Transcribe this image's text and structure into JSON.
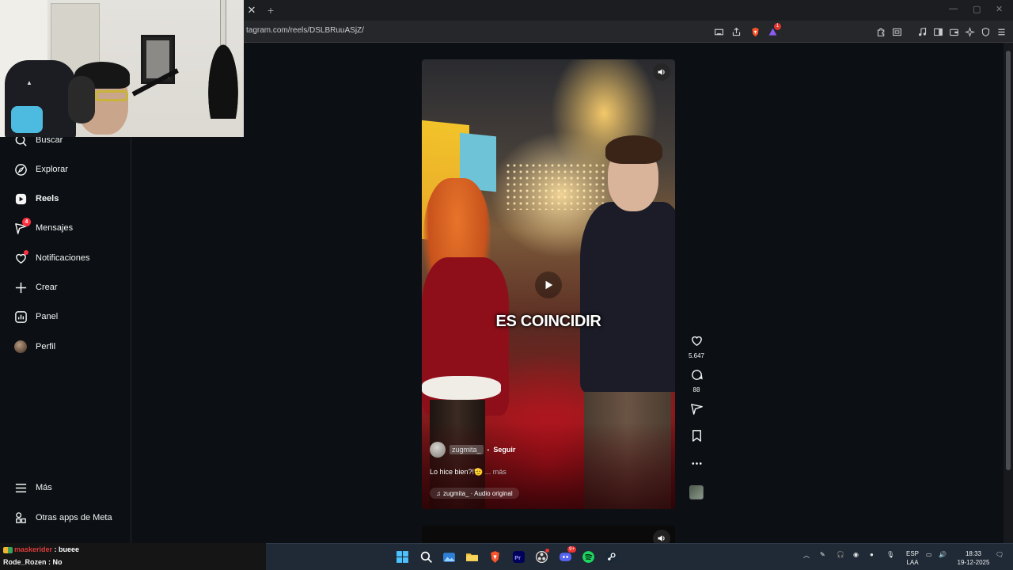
{
  "browser": {
    "url": "tagram.com/reels/DSLBRuuASjZ/",
    "extension_badge": "1"
  },
  "sidebar": {
    "items": [
      {
        "label": "Buscar",
        "icon": "search-icon"
      },
      {
        "label": "Explorar",
        "icon": "compass-icon"
      },
      {
        "label": "Reels",
        "icon": "reels-icon"
      },
      {
        "label": "Mensajes",
        "icon": "messenger-icon",
        "badge": "4"
      },
      {
        "label": "Notificaciones",
        "icon": "heart-icon"
      },
      {
        "label": "Crear",
        "icon": "plus-icon"
      },
      {
        "label": "Panel",
        "icon": "chart-icon"
      },
      {
        "label": "Perfil",
        "icon": "avatar"
      },
      {
        "label": "Más",
        "icon": "menu-icon"
      },
      {
        "label": "Otras apps de Meta",
        "icon": "apps-icon"
      }
    ]
  },
  "reel": {
    "caption_overlay": "ES COINCIDIR",
    "username": "zugmita_",
    "separator": "•",
    "follow_label": "Seguir",
    "description": "Lo hice bien?!🫡",
    "more_label": "... más",
    "audio": "zugmita_ · Audio original"
  },
  "actions": {
    "likes": "5.647",
    "comments": "88"
  },
  "chat": {
    "messages": [
      {
        "user": "maskerider",
        "text": "bueee"
      },
      {
        "user": "Rode_Rozen",
        "text": "No"
      }
    ]
  },
  "taskbar": {
    "lang_line1": "ESP",
    "lang_line2": "LAA",
    "time": "18:33",
    "date": "19-12-2025",
    "discord_badge": "9+"
  },
  "colors": {
    "page_bg": "#0c1014",
    "notification_red": "#ff3040",
    "taskbar_bg": "#1f2a36"
  }
}
